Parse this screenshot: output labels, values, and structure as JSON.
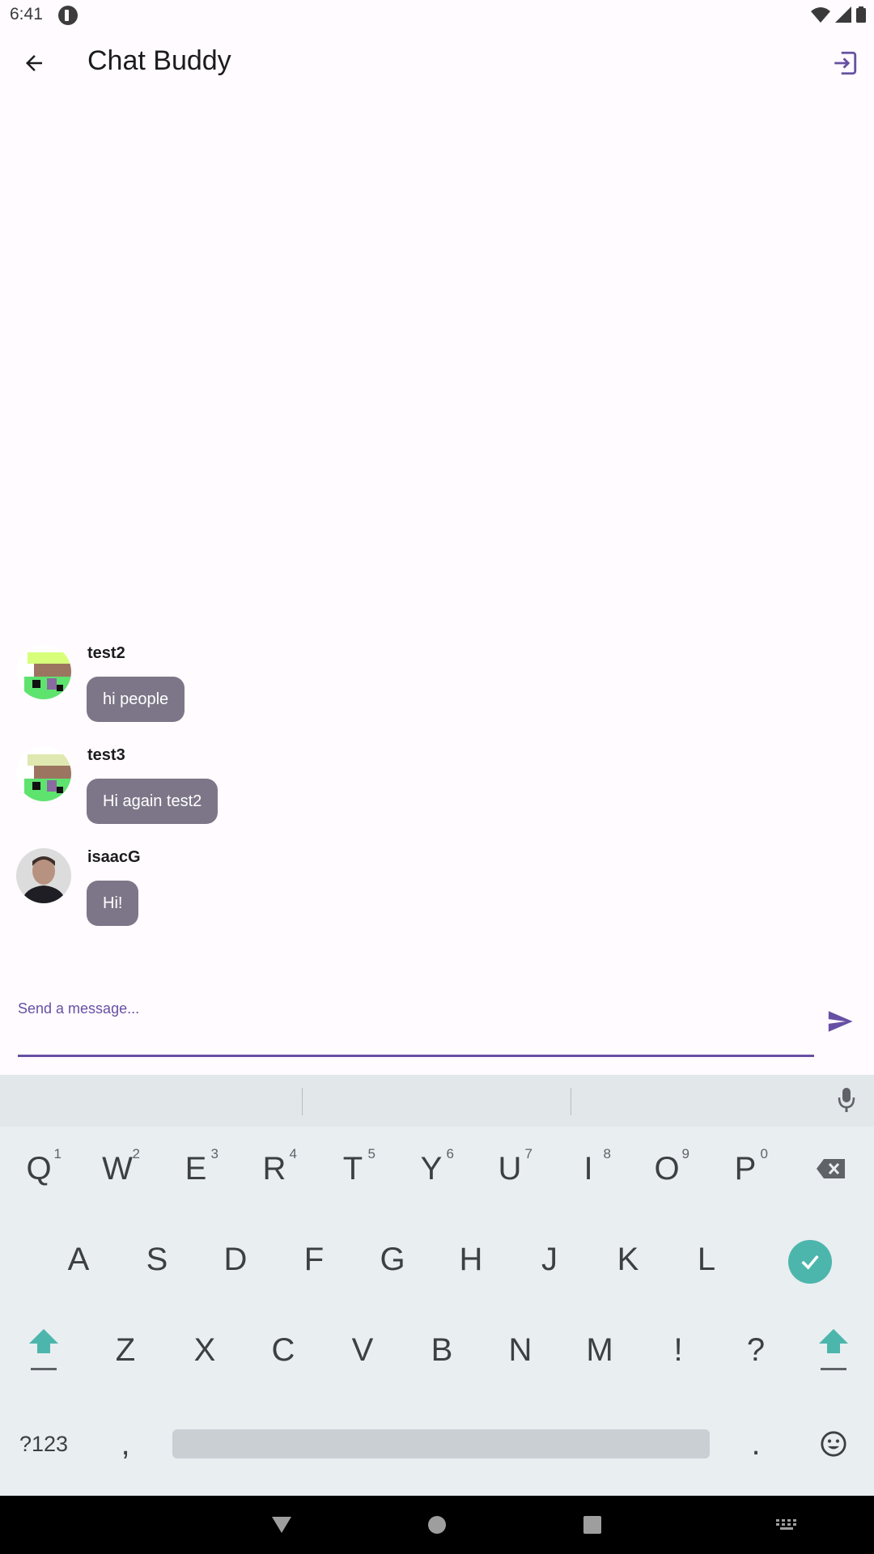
{
  "status_bar": {
    "time": "6:41"
  },
  "app_bar": {
    "title": "Chat Buddy"
  },
  "messages": [
    {
      "sender": "test2",
      "text": "hi people",
      "avatar": "pixel-avatar"
    },
    {
      "sender": "test3",
      "text": "Hi again test2",
      "avatar": "pixel-avatar"
    },
    {
      "sender": "isaacG",
      "text": "Hi!",
      "avatar": "photo-avatar"
    }
  ],
  "composer": {
    "placeholder": "Send a message...",
    "value": ""
  },
  "keyboard": {
    "row1": [
      "Q",
      "W",
      "E",
      "R",
      "T",
      "Y",
      "U",
      "I",
      "O",
      "P"
    ],
    "row1_hints": [
      "1",
      "2",
      "3",
      "4",
      "5",
      "6",
      "7",
      "8",
      "9",
      "0"
    ],
    "row2": [
      "A",
      "S",
      "D",
      "F",
      "G",
      "H",
      "J",
      "K",
      "L"
    ],
    "row3": [
      "Z",
      "X",
      "C",
      "V",
      "B",
      "N",
      "M",
      "!",
      "?"
    ],
    "symbols_label": "?123",
    "comma": ",",
    "period": "."
  },
  "colors": {
    "accent": "#6750a4",
    "bubble": "#7d7688",
    "background": "#fffbfe",
    "keyboard_accent": "#4db6ac"
  },
  "icons": [
    "back-arrow-icon",
    "logout-icon",
    "send-icon",
    "mic-icon",
    "backspace-icon",
    "checkmark-icon",
    "shift-icon",
    "emoji-icon",
    "wifi-icon",
    "signal-icon",
    "battery-icon"
  ]
}
